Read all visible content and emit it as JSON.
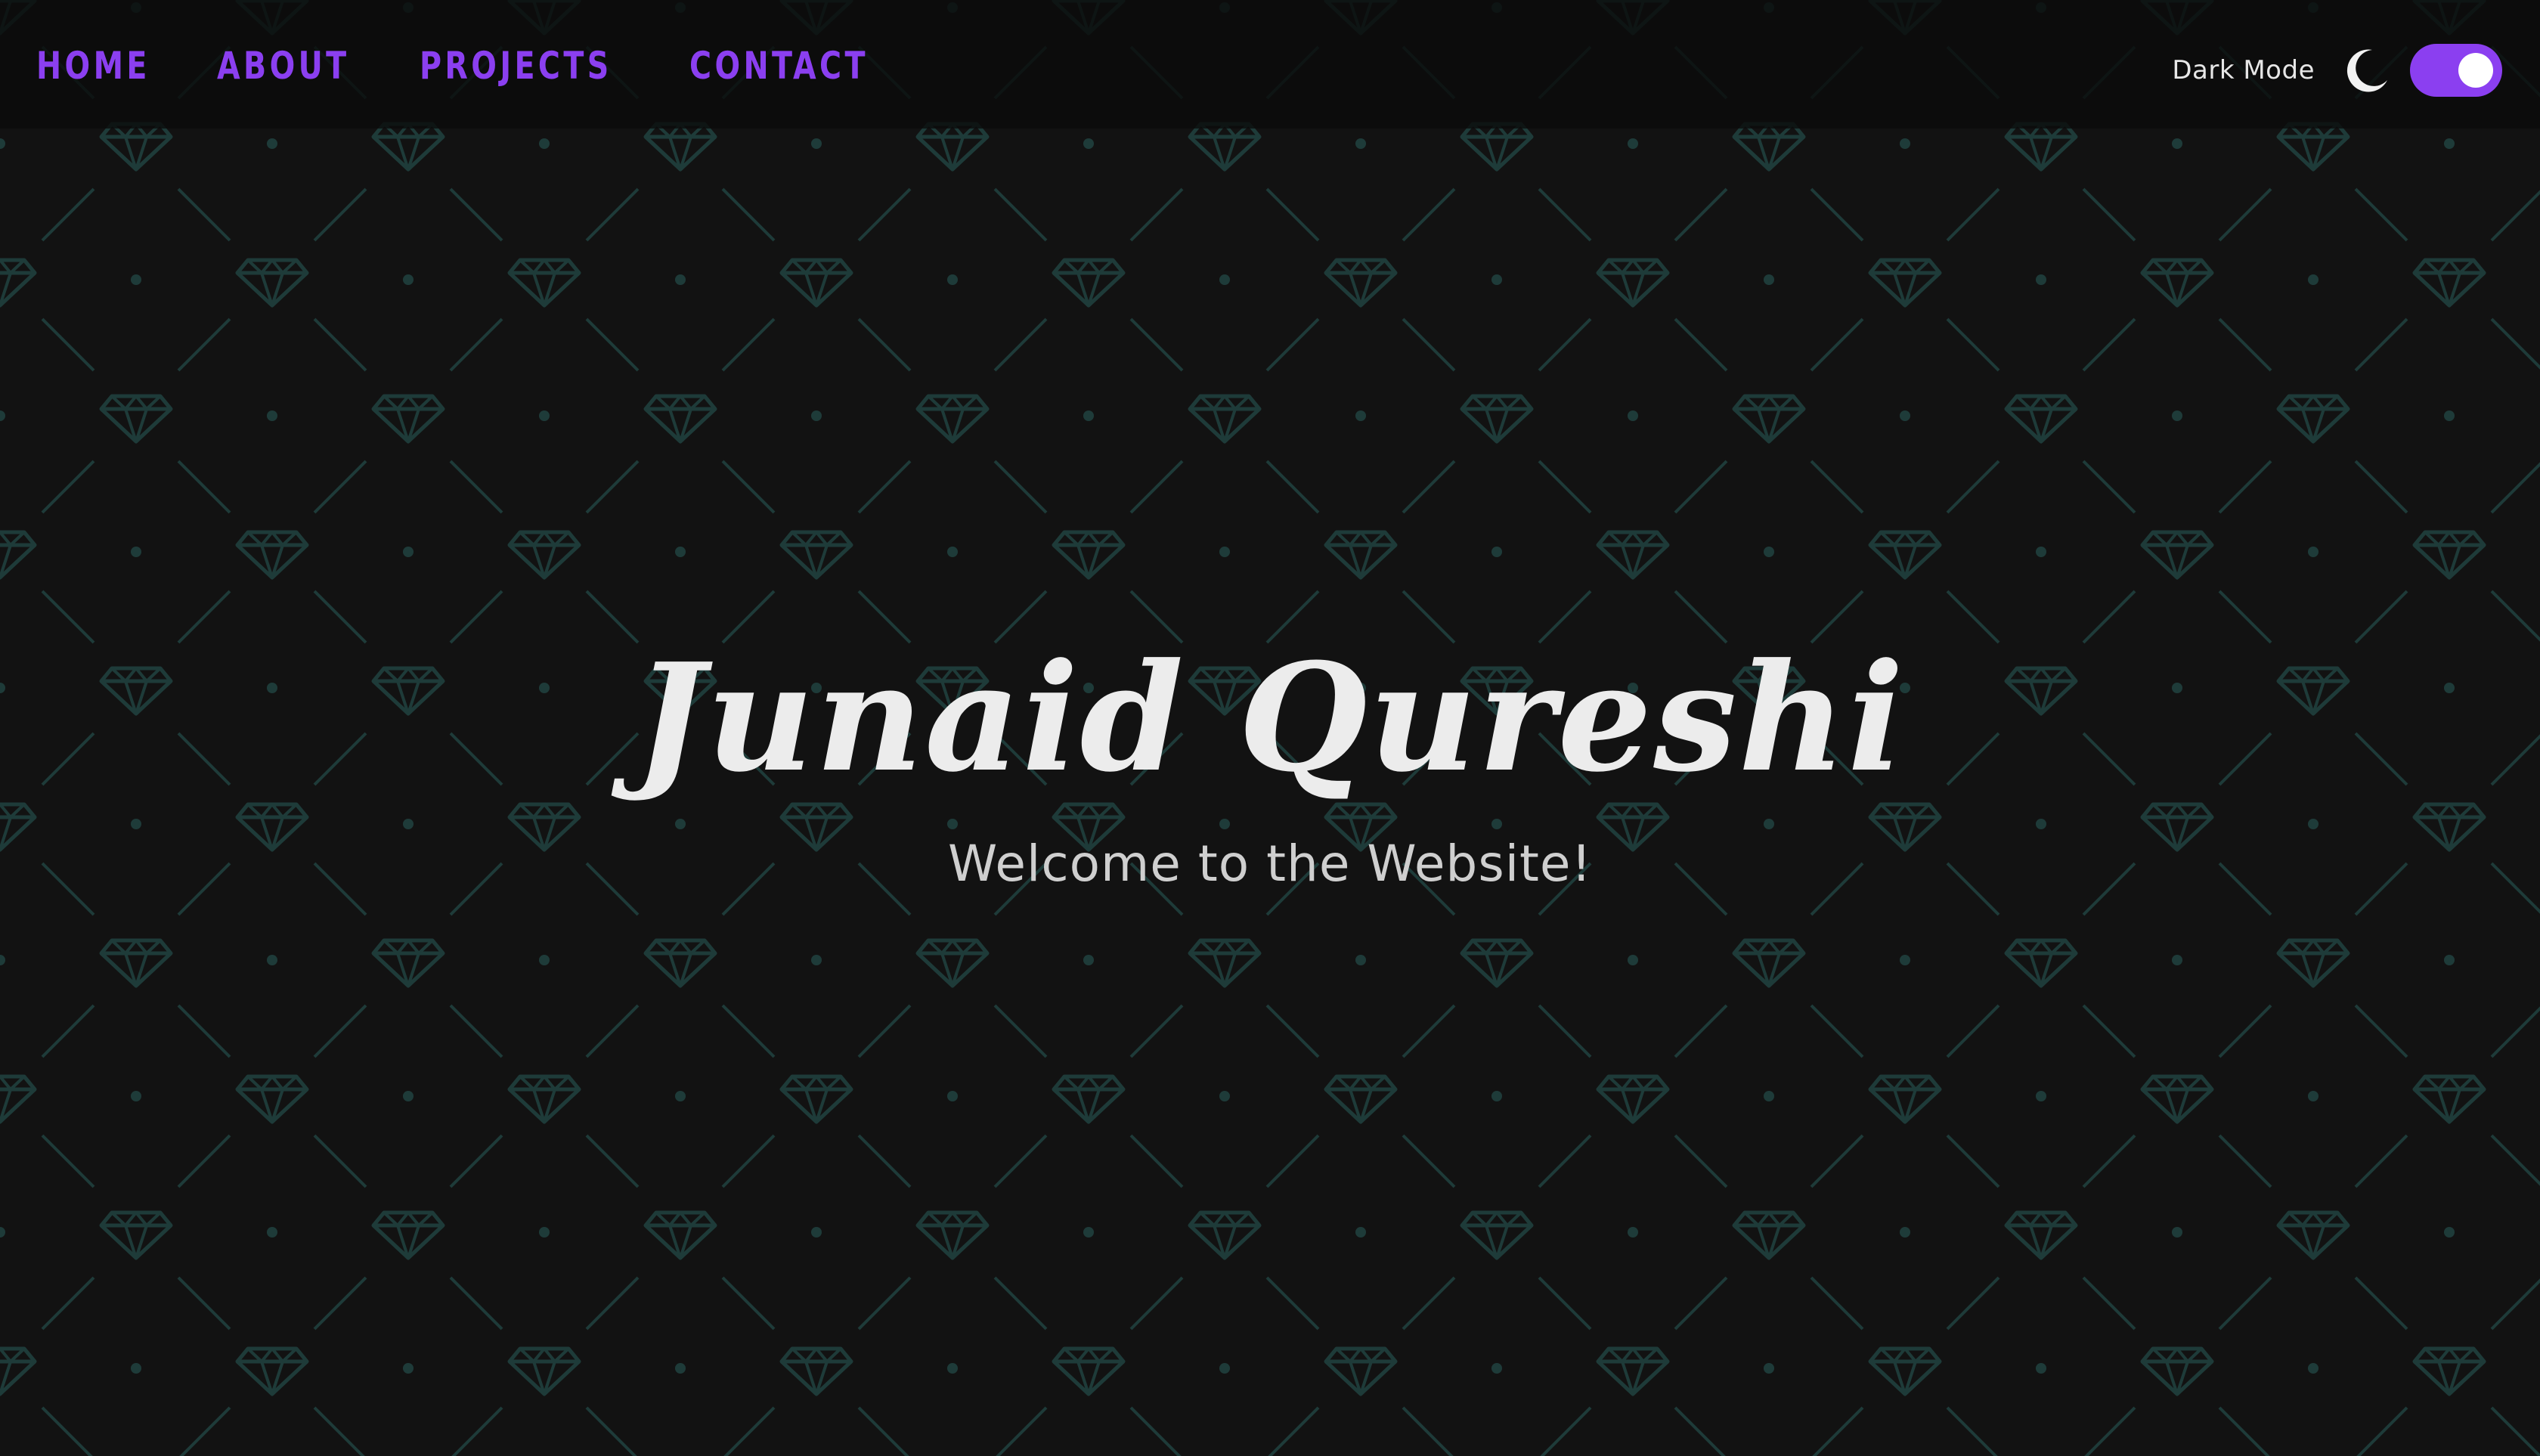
{
  "nav": {
    "items": [
      {
        "label": "HOME"
      },
      {
        "label": "ABOUT"
      },
      {
        "label": "PROJECTS"
      },
      {
        "label": "CONTACT"
      }
    ]
  },
  "theme": {
    "mode_label": "Dark Mode",
    "dark_mode_enabled": true,
    "accent_color": "#8b3ff0",
    "background_color": "#121212",
    "pattern_color": "#1f3f3d"
  },
  "hero": {
    "title": "Junaid Qureshi",
    "subtitle": "Welcome to the Website!"
  }
}
